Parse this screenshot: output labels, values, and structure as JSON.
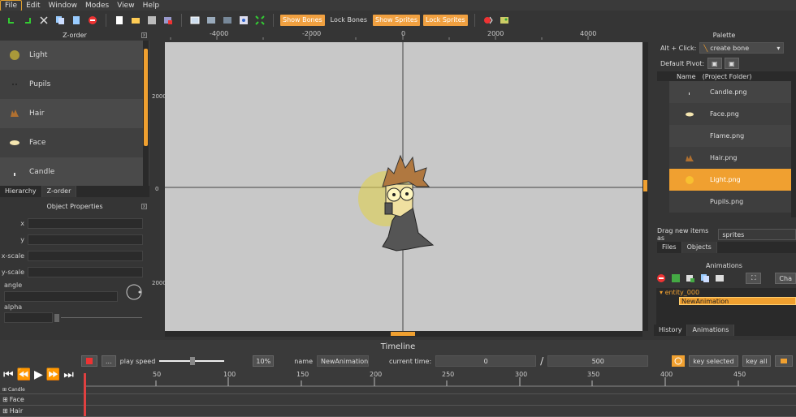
{
  "menu": [
    "File",
    "Edit",
    "Window",
    "Modes",
    "View",
    "Help"
  ],
  "toolbar": {
    "show_bones": "Show Bones",
    "lock_bones": "Lock Bones",
    "show_sprites": "Show Sprites",
    "lock_sprites": "Lock Sprites"
  },
  "zorder": {
    "title": "Z-order",
    "items": [
      "Light",
      "Pupils",
      "Hair",
      "Face",
      "Candle"
    ],
    "tabs": [
      "Hierarchy",
      "Z-order"
    ]
  },
  "object_properties": {
    "title": "Object Properties",
    "labels": [
      "x",
      "y",
      "x-scale",
      "y-scale"
    ],
    "angle_label": "angle",
    "alpha_label": "alpha"
  },
  "rulers": {
    "h_ticks": [
      "-4000",
      "-2000",
      "0",
      "2000",
      "4000"
    ],
    "v_ticks": [
      "2000",
      "0",
      "2000"
    ]
  },
  "palette": {
    "title": "Palette",
    "alt_click_label": "Alt + Click:",
    "alt_click_value": "create bone",
    "default_pivot_label": "Default Pivot:",
    "col_name": "Name",
    "col_folder": "(Project Folder)",
    "files": [
      "Candle.png",
      "Face.png",
      "Flame.png",
      "Hair.png",
      "Light.png",
      "Pupils.png"
    ],
    "selected_file": "Light.png",
    "drag_label": "Drag new items as",
    "drag_value": "sprites",
    "tabs": [
      "Files",
      "Objects"
    ]
  },
  "animations": {
    "title": "Animations",
    "chain_button": "Cha",
    "entity": "entity_000",
    "animation": "NewAnimation",
    "tabs": [
      "History",
      "Animations"
    ]
  },
  "timeline": {
    "title": "Timeline",
    "more_button": "...",
    "play_speed_label": "play speed",
    "play_speed_value": "10%",
    "name_label": "name",
    "name_value": "NewAnimation",
    "current_time_label": "current time:",
    "current_time_value": "0",
    "slash": "/",
    "length_value": "500",
    "key_selected": "key selected",
    "key_all": "key all",
    "ruler_labels": [
      "50",
      "100",
      "150",
      "200",
      "250",
      "300",
      "350",
      "400",
      "450"
    ],
    "tracks": [
      "Candle",
      "Face",
      "Hair"
    ]
  },
  "colors": {
    "accent": "#f0a030",
    "canvas_bg": "#c8c8c8",
    "panel_bg": "#353535"
  }
}
